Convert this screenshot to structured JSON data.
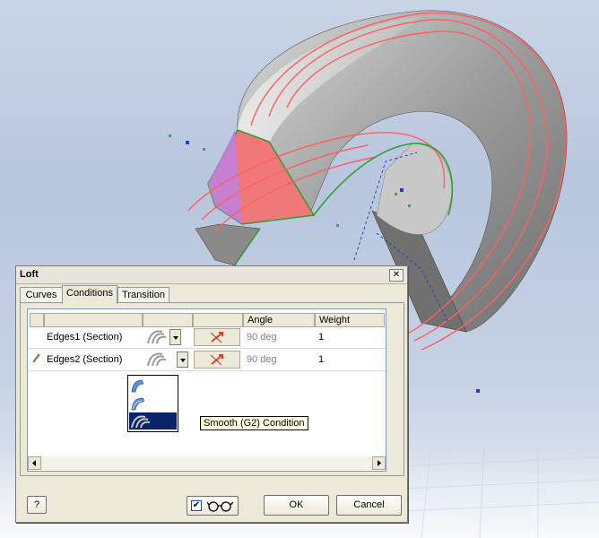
{
  "dialog": {
    "title": "Loft",
    "close_label": "✕",
    "tabs": [
      {
        "label": "Curves",
        "active": false
      },
      {
        "label": "Conditions",
        "active": true
      },
      {
        "label": "Transition",
        "active": false
      }
    ],
    "columns": [
      "",
      "",
      "",
      "Angle",
      "Weight"
    ],
    "rows": [
      {
        "name": "Edges1 (Section)",
        "angle": "90 deg",
        "weight": "1",
        "edit_marker": ""
      },
      {
        "name": "Edges2 (Section)",
        "angle": "90 deg",
        "weight": "1",
        "edit_marker": "pencil"
      }
    ],
    "condition_options": [
      {
        "icon": "tangent-condition-icon",
        "selected": false
      },
      {
        "icon": "smooth-g2-condition-icon-alt",
        "selected": false
      },
      {
        "icon": "smooth-g2-condition-icon",
        "selected": true
      }
    ],
    "tooltip": "Smooth (G2) Condition",
    "preview_checked": true,
    "ok_label": "OK",
    "cancel_label": "Cancel",
    "help_label": "?"
  },
  "colors": {
    "accent_selection": "#0a246a",
    "profile_red": "#ff6060",
    "profile_green": "#2e9e2e",
    "section_face": "#f07878",
    "section_violet": "#c080e0"
  }
}
